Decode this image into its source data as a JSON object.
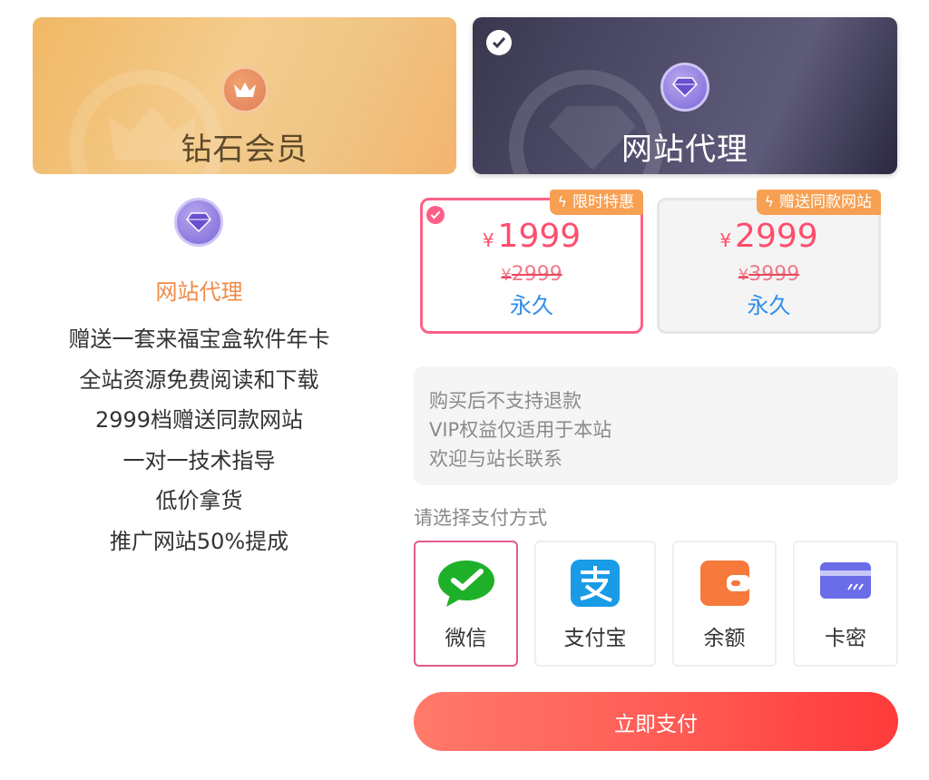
{
  "tiers": [
    {
      "title": "钻石会员",
      "selected": false,
      "icon": "crown-icon"
    },
    {
      "title": "网站代理",
      "selected": true,
      "icon": "diamond-icon"
    }
  ],
  "info": {
    "icon": "diamond-icon",
    "name": "网站代理",
    "benefits": [
      "赠送一套来福宝盒软件年卡",
      "全站资源免费阅读和下载",
      "2999档赠送同款网站",
      "一对一技术指导",
      "低价拿货",
      "推广网站50%提成"
    ]
  },
  "prices": [
    {
      "badge": "限时特惠",
      "currency": "¥",
      "price": "1999",
      "original": "2999",
      "term": "永久",
      "selected": true
    },
    {
      "badge": "赠送同款网站",
      "currency": "¥",
      "price": "2999",
      "original": "3999",
      "term": "永久",
      "selected": false
    }
  ],
  "notice": [
    "购买后不支持退款",
    "VIP权益仅适用于本站",
    "欢迎与站长联系"
  ],
  "payment": {
    "label": "请选择支付方式",
    "methods": [
      {
        "label": "微信",
        "icon": "wechat-icon",
        "selected": true
      },
      {
        "label": "支付宝",
        "icon": "alipay-icon",
        "selected": false
      },
      {
        "label": "余额",
        "icon": "wallet-icon",
        "selected": false
      },
      {
        "label": "卡密",
        "icon": "card-icon",
        "selected": false
      }
    ]
  },
  "submit_label": "立即支付",
  "colors": {
    "accent": "#ff5f86",
    "price": "#ff4d6d",
    "term": "#2f8ee8",
    "badge": "#f7a052",
    "pay_selected_border": "#e05a8f"
  }
}
